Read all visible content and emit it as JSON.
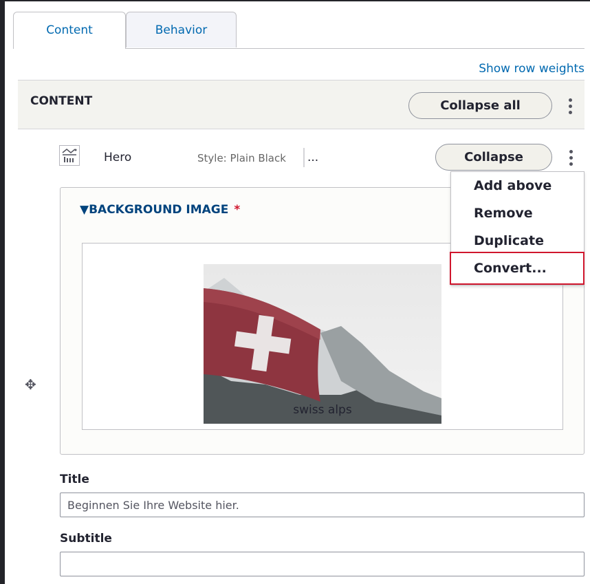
{
  "tabs": [
    {
      "label": "Content",
      "active": true
    },
    {
      "label": "Behavior",
      "active": false
    }
  ],
  "show_row_weights": "Show row weights",
  "content_section": {
    "title": "CONTENT",
    "collapse_all_label": "Collapse all"
  },
  "paragraph": {
    "type_label": "Hero",
    "icon": "hero-paragraph-icon",
    "summary": "Style: Plain Black",
    "summary_more": "...",
    "collapse_label": "Collapse",
    "menu": {
      "items": [
        "Add above",
        "Remove",
        "Duplicate",
        "Convert..."
      ],
      "highlighted": "Convert..."
    }
  },
  "background_image": {
    "legend": "BACKGROUND IMAGE",
    "required_marker": "*",
    "caption": "swiss alps"
  },
  "fields": {
    "title_label": "Title",
    "title_value": "Beginnen Sie Ihre Website hier.",
    "subtitle_label": "Subtitle",
    "subtitle_value": ""
  },
  "colors": {
    "link": "#0069b0",
    "legend": "#00437d",
    "required": "#d0162d",
    "highlight_border": "#d0162d"
  }
}
